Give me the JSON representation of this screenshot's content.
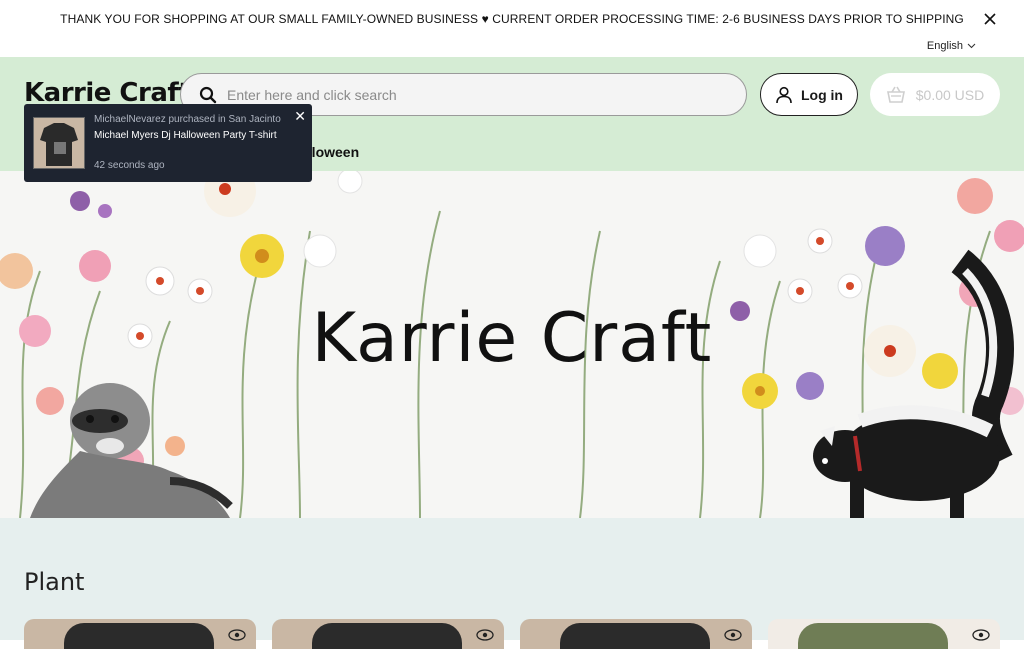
{
  "announcement": {
    "text": "THANK YOU FOR SHOPPING AT OUR SMALL FAMILY-OWNED BUSINESS ♥ CURRENT ORDER PROCESSING TIME: 2-6 BUSINESS DAYS PRIOR TO SHIPPING",
    "close_icon": "close-icon"
  },
  "language": {
    "label": "English"
  },
  "header": {
    "logo": "Karrie Craft",
    "search_placeholder": "Enter here and click search",
    "login_label": "Log in",
    "cart_total": "$0.00 USD"
  },
  "nav": {
    "items": [
      {
        "label": "alloween"
      }
    ]
  },
  "hero": {
    "title": "Karrie Craft"
  },
  "section": {
    "title": "Plant"
  },
  "toast": {
    "who": "MichaelNevarez purchased in San Jacinto",
    "product": "Michael Myers Dj Halloween Party T-shirt",
    "time": "42 seconds ago"
  },
  "colors": {
    "header_bg": "#d5ecd4",
    "section_bg": "#e6efee",
    "toast_bg": "#1e2430"
  }
}
